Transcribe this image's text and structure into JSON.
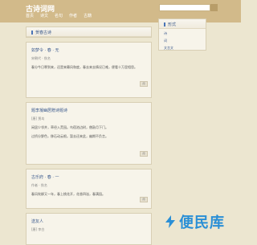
{
  "header": {
    "logo": "古诗词网",
    "nav": [
      "首页",
      "诗文",
      "名句",
      "作者",
      "古籍"
    ],
    "search_placeholder": ""
  },
  "main": {
    "section_title": "贺春古诗",
    "cards": [
      {
        "title": "如梦令 · 春 · 无",
        "meta": "宋朝代 · 佚名",
        "lines": [
          "春分今日寒到来，还是来幕风和度，春去来去情况已难，便看十万里相思。"
        ],
        "more": "阅"
      },
      {
        "title": "题李凝幽居赠诗题诗",
        "meta": "[唐] 贾岛",
        "lines": [
          "闲居少邻并，草径入荒园。鸟宿池边树，僧敲月下门。",
          "过桥分野色，移石动云根。暂去还来此，幽期不负言。"
        ],
        "more": "阅"
      },
      {
        "title": "古乐府 · 春 · 一",
        "meta": "作者 · 佚名",
        "lines": [
          "春风吹柳又一年，春上桃花开，花香四溢，春满园。"
        ],
        "more": "阅"
      },
      {
        "title": "送友人",
        "meta": "[唐] 李白",
        "lines": [],
        "more": ""
      }
    ]
  },
  "sidebar": {
    "title": "形式",
    "items": [
      "诗",
      "词",
      "文言文"
    ]
  },
  "watermark": {
    "text": "便民库"
  }
}
